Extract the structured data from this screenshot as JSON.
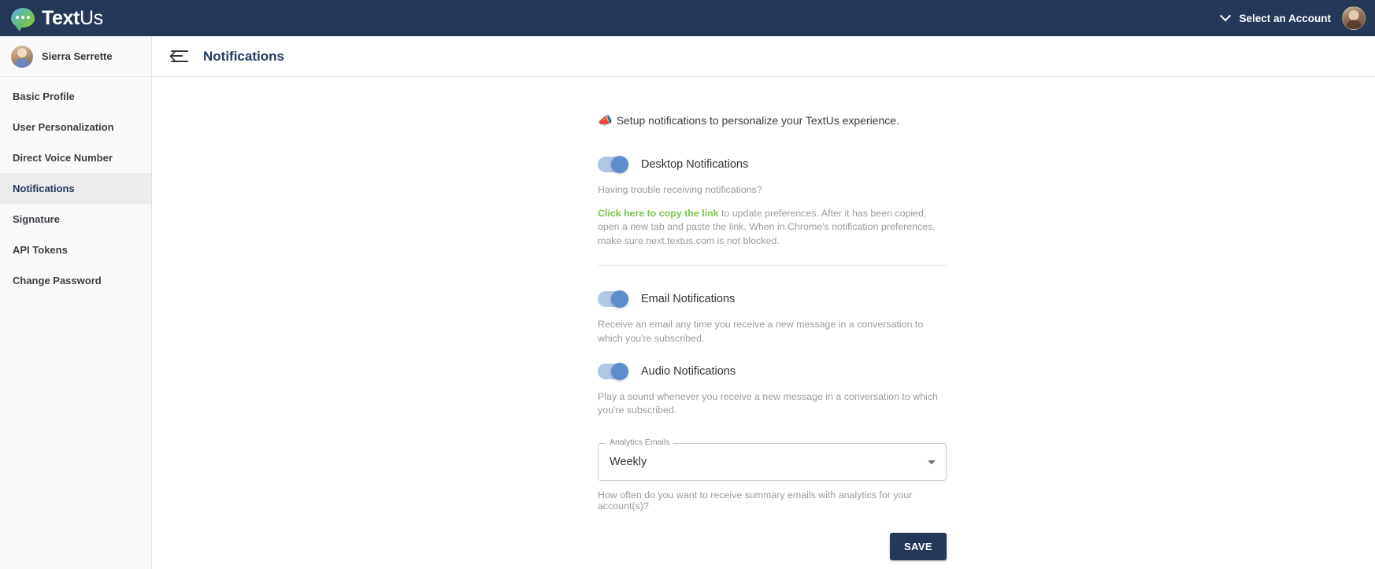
{
  "topbar": {
    "brand_bold": "Text",
    "brand_light": "Us",
    "account_selector_label": "Select an Account"
  },
  "sidebar": {
    "user_name": "Sierra Serrette",
    "items": [
      {
        "label": "Basic Profile",
        "active": false
      },
      {
        "label": "User Personalization",
        "active": false
      },
      {
        "label": "Direct Voice Number",
        "active": false
      },
      {
        "label": "Notifications",
        "active": true
      },
      {
        "label": "Signature",
        "active": false
      },
      {
        "label": "API Tokens",
        "active": false
      },
      {
        "label": "Change Password",
        "active": false
      }
    ]
  },
  "main": {
    "page_title": "Notifications",
    "intro_emoji": "📣",
    "intro_text": "Setup notifications to personalize your TextUs experience.",
    "desktop": {
      "toggle_label": "Desktop Notifications",
      "trouble_text": "Having trouble receiving notifications?",
      "link_text": "Click here to copy the link",
      "after_link_text": " to update preferences. After it has been copied, open a new tab and paste the link. When in Chrome's notification preferences, make sure next.textus.com is not blocked."
    },
    "email": {
      "toggle_label": "Email Notifications",
      "description": "Receive an email any time you receive a new message in a conversation to which you're subscribed."
    },
    "audio": {
      "toggle_label": "Audio Notifications",
      "description": "Play a sound whenever you receive a new message in a conversation to which you're subscribed."
    },
    "analytics": {
      "field_label": "Analytics Emails",
      "selected_value": "Weekly",
      "helper_text": "How often do you want to receive summary emails with analytics for your account(s)?"
    },
    "save_label": "SAVE"
  },
  "colors": {
    "navy": "#253858",
    "toggle_on": "#5b8ecb",
    "link_green": "#7cc34a"
  }
}
